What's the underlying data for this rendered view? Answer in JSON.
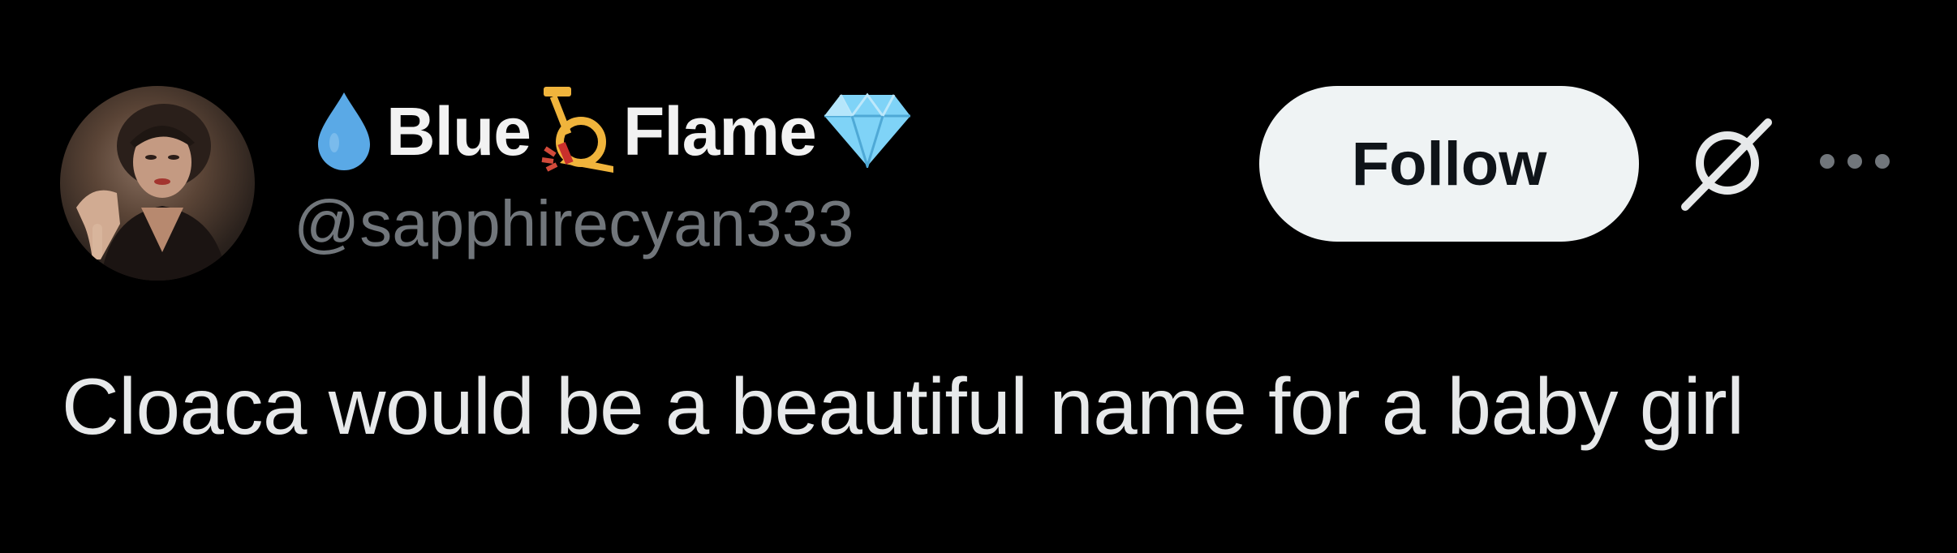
{
  "post": {
    "author": {
      "display_name_parts": [
        "Blue",
        "Flame"
      ],
      "handle": "@sapphirecyan333",
      "name_emojis": [
        "droplet",
        "postal-horn",
        "gem"
      ]
    },
    "follow_label": "Follow",
    "text": "Cloaca would be a beautiful name for a baby girl"
  },
  "icons": {
    "grok": "grok-icon",
    "more": "more-options-icon"
  },
  "colors": {
    "background": "#000000",
    "text_primary": "#e7e9ea",
    "text_secondary": "#71767b",
    "follow_bg": "#eff3f4",
    "follow_text": "#0f1419",
    "droplet": "#5aa9e6",
    "gem": "#7fd3f7",
    "horn": "#f0b43c"
  }
}
